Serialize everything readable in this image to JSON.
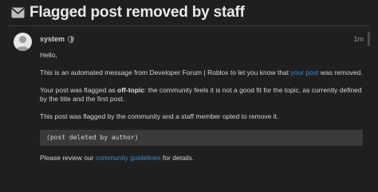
{
  "topic": {
    "title": "Flagged post removed by staff",
    "icon": "envelope-icon"
  },
  "post": {
    "username": "system",
    "badge_icon": "shield-icon",
    "date": "1m",
    "greeting": "Hello,",
    "para1_before": "This is an automated message from Developer Forum | Roblox to let you know that ",
    "para1_link": "your post",
    "para1_after": " was removed.",
    "para2_before": "Your post was flagged as ",
    "para2_strong": "off-topic",
    "para2_after": ": the community feels it is not a good fit for the topic, as currently defined by the title and the first post.",
    "para3": "This post was flagged by the community and a staff member opted to remove it.",
    "code": "(post deleted by author)",
    "para4_before": "Please review our ",
    "para4_link": "community guidelines",
    "para4_after": " for details."
  },
  "colors": {
    "background": "#1f1f1f",
    "link": "#3b8fd0",
    "code_bg": "#3a3a3a"
  }
}
